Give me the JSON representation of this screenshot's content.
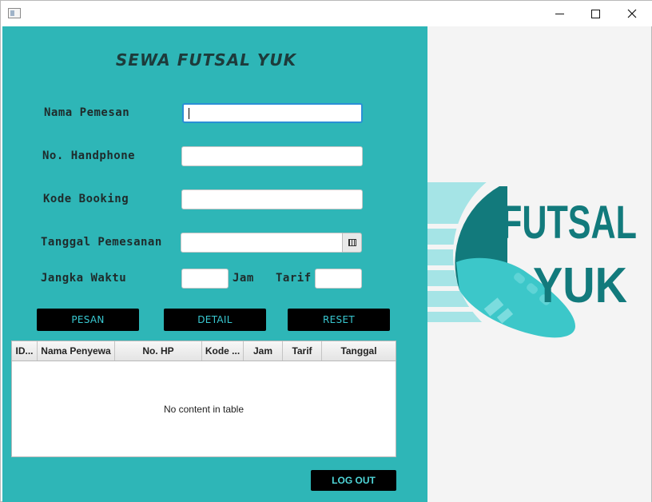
{
  "window": {
    "controls": {
      "minimize": "minimize-icon",
      "maximize": "maximize-icon",
      "close": "close-icon"
    }
  },
  "form": {
    "title": "SEWA FUTSAL YUK",
    "fields": {
      "nama_label": "Nama Pemesan",
      "nama_value": "",
      "hp_label": "No. Handphone",
      "hp_value": "",
      "kode_label": "Kode Booking",
      "kode_value": "",
      "tanggal_label": "Tanggal Pemesanan",
      "tanggal_value": "",
      "jangka_label": "Jangka Waktu",
      "jangka_value": "",
      "jam_label": "Jam",
      "tarif_label": "Tarif",
      "tarif_value": ""
    },
    "buttons": {
      "pesan": "PESAN",
      "detail": "DETAIL",
      "reset": "RESET"
    }
  },
  "table": {
    "columns": [
      "ID...",
      "Nama Penyewa",
      "No. HP",
      "Kode ...",
      "Jam",
      "Tarif",
      "Tanggal"
    ],
    "rows": [],
    "empty_message": "No content in table"
  },
  "footer": {
    "logout": "LOG OUT"
  },
  "logo": {
    "line1": "FUTSAL",
    "line2": "YUK",
    "colors": {
      "primary": "#127a7c",
      "light": "#3cc7c9",
      "pale": "#a5e4e6"
    }
  },
  "theme": {
    "panel": "#2eb6b7",
    "button_bg": "#000000",
    "button_text": "#39c9d2"
  }
}
